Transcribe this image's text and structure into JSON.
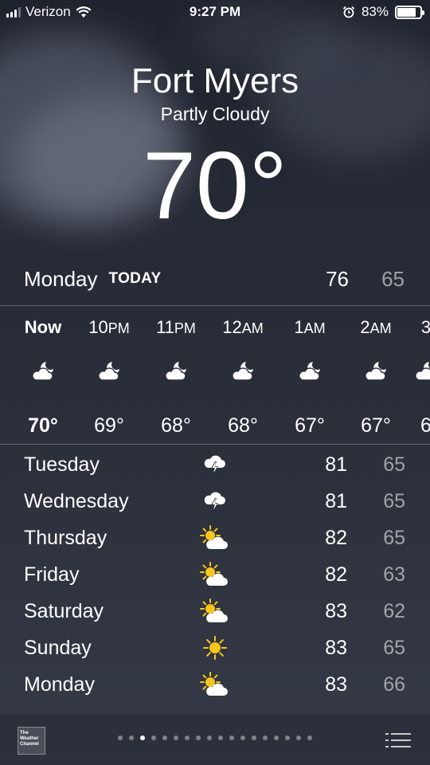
{
  "status": {
    "carrier": "Verizon",
    "time": "9:27 PM",
    "battery": "83%",
    "battery_level": 0.83
  },
  "location": {
    "city": "Fort Myers",
    "condition": "Partly Cloudy",
    "temperature": "70°"
  },
  "today": {
    "day": "Monday",
    "label": "TODAY",
    "high": "76",
    "low": "65"
  },
  "hourly": [
    {
      "hour": "Now",
      "period": "",
      "temp": "70°",
      "icon": "partly-cloudy-night-icon"
    },
    {
      "hour": "10",
      "period": "PM",
      "temp": "69°",
      "icon": "partly-cloudy-night-icon"
    },
    {
      "hour": "11",
      "period": "PM",
      "temp": "68°",
      "icon": "partly-cloudy-night-icon"
    },
    {
      "hour": "12",
      "period": "AM",
      "temp": "68°",
      "icon": "partly-cloudy-night-icon"
    },
    {
      "hour": "1",
      "period": "AM",
      "temp": "67°",
      "icon": "partly-cloudy-night-icon"
    },
    {
      "hour": "2",
      "period": "AM",
      "temp": "67°",
      "icon": "partly-cloudy-night-icon"
    },
    {
      "hour": "3",
      "period": "",
      "temp": "6",
      "icon": "partly-cloudy-night-icon"
    }
  ],
  "daily": [
    {
      "day": "Tuesday",
      "icon": "thunderstorm-icon",
      "high": "81",
      "low": "65"
    },
    {
      "day": "Wednesday",
      "icon": "thunderstorm-icon",
      "high": "81",
      "low": "65"
    },
    {
      "day": "Thursday",
      "icon": "partly-sunny-icon",
      "high": "82",
      "low": "65"
    },
    {
      "day": "Friday",
      "icon": "partly-sunny-icon",
      "high": "82",
      "low": "63"
    },
    {
      "day": "Saturday",
      "icon": "partly-sunny-icon",
      "high": "83",
      "low": "62"
    },
    {
      "day": "Sunday",
      "icon": "sunny-icon",
      "high": "83",
      "low": "65"
    },
    {
      "day": "Monday",
      "icon": "partly-sunny-icon",
      "high": "83",
      "low": "66"
    }
  ],
  "footer": {
    "brand_logo": "The Weather Channel",
    "page_count": 18,
    "active_page": 3,
    "list_icon": "list-icon"
  }
}
